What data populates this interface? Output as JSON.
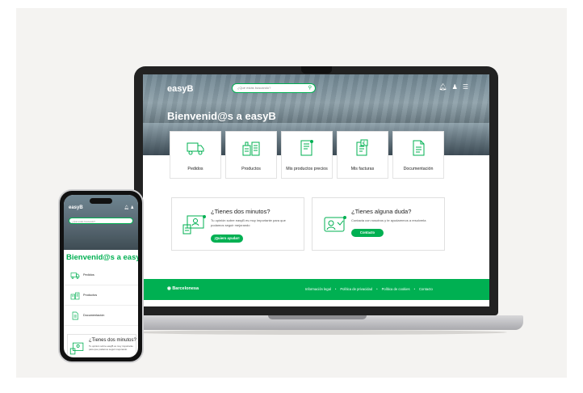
{
  "brand": "easyB",
  "search": {
    "placeholder": "¿Qué estás buscando?"
  },
  "welcome": "Bienvenid@s a easyB",
  "cards": [
    {
      "label": "Pedidos",
      "icon": "truck-icon"
    },
    {
      "label": "Productos",
      "icon": "factory-icon"
    },
    {
      "label": "Mis productos precios",
      "icon": "price-list-icon"
    },
    {
      "label": "Mis facturas",
      "icon": "invoice-icon"
    },
    {
      "label": "Documentación",
      "icon": "document-icon"
    }
  ],
  "feature_boxes": [
    {
      "title": "¿Tienes dos minutos?",
      "text": "Tu opinión sobre easyB es muy importante para que podamos seguir mejorando",
      "button": "¡Quiero ayudar!"
    },
    {
      "title": "¿Tienes alguna duda?",
      "text": "Contacta con nosotros y te ayudaremos a resolverla",
      "button": "Contacto"
    }
  ],
  "footer": {
    "logo": "Barcelonesa",
    "links": [
      "Información legal",
      "Política de privacidad",
      "Política de cookies",
      "Contacto"
    ]
  },
  "mobile": {
    "brand": "easyB",
    "search_placeholder": "¿Qué estás buscando?",
    "welcome": "Bienvenid@s a easyB",
    "items": [
      "Pedidos",
      "Productos",
      "Documentación"
    ],
    "box": {
      "title": "¿Tienes dos minutos?",
      "text": "Tu opinión sobre easyB es muy importante para que podamos seguir mejorando"
    }
  },
  "colors": {
    "accent": "#00b052",
    "background": "#f4f3f1"
  }
}
